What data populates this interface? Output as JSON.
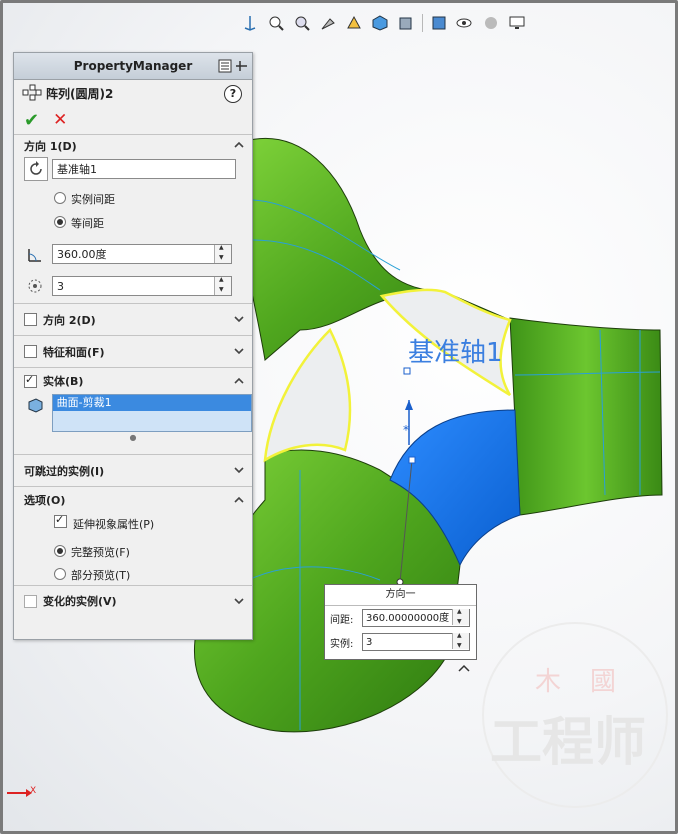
{
  "window": {
    "background": "#f4f5f7"
  },
  "hud_toolbar": {
    "icons": [
      "view-normal-icon",
      "zoom-to-fit-icon",
      "zoom-area-icon",
      "previous-view-icon",
      "section-view-icon",
      "view-orientation-icon",
      "display-style-icon",
      "hide-show-icon",
      "edit-appearance-icon",
      "apply-scene-icon",
      "view-settings-icon"
    ]
  },
  "property_manager": {
    "title": "PropertyManager",
    "feature_name": "阵列(圆周)2",
    "help": "?",
    "ok_symbol": "✔",
    "cancel_symbol": "✕",
    "direction1": {
      "header": "方向 1(D)",
      "axis_value": "基准轴1",
      "option_instance_spacing": "实例间距",
      "option_equal_spacing": "等间距",
      "selected_option": "等间距",
      "angle_value": "360.00度",
      "instances_value": "3"
    },
    "direction2": {
      "header": "方向 2(D)",
      "checked": false
    },
    "features_faces": {
      "header": "特征和面(F)",
      "checked": false
    },
    "bodies": {
      "header": "实体(B)",
      "checked": true,
      "selected_item": "曲面-剪裁1"
    },
    "skip_instances": {
      "header": "可跳过的实例(I)"
    },
    "options": {
      "header": "选项(O)",
      "propagate_visual": "延伸视象属性(P)",
      "propagate_checked": true,
      "full_preview": "完整预览(F)",
      "partial_preview": "部分预览(T)",
      "selected_preview": "完整预览(F)"
    },
    "varied_instances": {
      "header": "变化的实例(V)",
      "checked": false
    }
  },
  "graphics": {
    "axis_label": "基准轴1",
    "body_color": "#5fb82a",
    "highlight_color": "#1a7ff0",
    "edge_highlight": "#f2f23a"
  },
  "callout": {
    "title": "方向一",
    "spacing_label": "间距:",
    "spacing_value": "360.00000000度",
    "instances_label": "实例:",
    "instances_value": "3"
  },
  "triad": {
    "x_label": "X"
  },
  "watermark": {
    "text": "工程师",
    "top_chars": [
      "木",
      "國"
    ]
  }
}
